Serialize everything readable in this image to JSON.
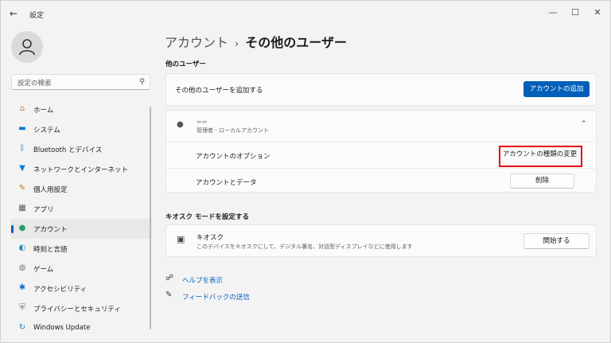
{
  "titlebar": {
    "app_title": "設定",
    "back_icon": "back-arrow-icon",
    "minimize": "—",
    "maximize": "☐",
    "close": "✕"
  },
  "sidebar": {
    "search_placeholder": "設定の検索",
    "items": [
      {
        "label": "ホーム",
        "icon": "home-icon",
        "glyph": "⌂",
        "color": "#c57a2c"
      },
      {
        "label": "システム",
        "icon": "system-icon",
        "glyph": "▬",
        "color": "#0078d4"
      },
      {
        "label": "Bluetooth とデバイス",
        "icon": "bluetooth-icon",
        "glyph": "ᛒ",
        "color": "#0078d4"
      },
      {
        "label": "ネットワークとインターネット",
        "icon": "wifi-icon",
        "glyph": "▼",
        "color": "#0a7dd6"
      },
      {
        "label": "個人用設定",
        "icon": "brush-icon",
        "glyph": "✎",
        "color": "#c86d1b"
      },
      {
        "label": "アプリ",
        "icon": "apps-icon",
        "glyph": "▦",
        "color": "#4a5a6a"
      },
      {
        "label": "アカウント",
        "icon": "account-icon",
        "glyph": "●",
        "color": "#2a9d6b"
      },
      {
        "label": "時刻と言語",
        "icon": "time-language-icon",
        "glyph": "◐",
        "color": "#1b82c5"
      },
      {
        "label": "ゲーム",
        "icon": "game-icon",
        "glyph": "◍",
        "color": "#777"
      },
      {
        "label": "アクセシビリティ",
        "icon": "accessibility-icon",
        "glyph": "✱",
        "color": "#1b6fc5"
      },
      {
        "label": "プライバシーとセキュリティ",
        "icon": "shield-icon",
        "glyph": "⛨",
        "color": "#6a6a6a"
      },
      {
        "label": "Windows Update",
        "icon": "update-icon",
        "glyph": "↻",
        "color": "#1b82c5"
      }
    ],
    "active_index": 6
  },
  "main": {
    "breadcrumb_parent": "アカウント",
    "breadcrumb_sep": "›",
    "breadcrumb_current": "その他のユーザー",
    "other_users_title": "他のユーザー",
    "add_user_label": "その他のユーザーを追加する",
    "add_account_button": "アカウントの追加",
    "user_name": "▬▬",
    "user_role": "管理者 - ローカルアカウント",
    "account_options_label": "アカウントのオプション",
    "change_type_button": "アカウントの種類の変更",
    "account_data_label": "アカウントとデータ",
    "delete_button": "削除",
    "kiosk_section_title": "キオスク モードを設定する",
    "kiosk_title": "キオスク",
    "kiosk_desc": "このデバイスをキオスクにして、デジタル署名、対話型ディスプレイなどに使用します",
    "kiosk_button": "開始する",
    "help_link": "ヘルプを表示",
    "feedback_link": "フィードバックの送信"
  },
  "colors": {
    "accent": "#005fb8",
    "highlight": "#e60012"
  }
}
